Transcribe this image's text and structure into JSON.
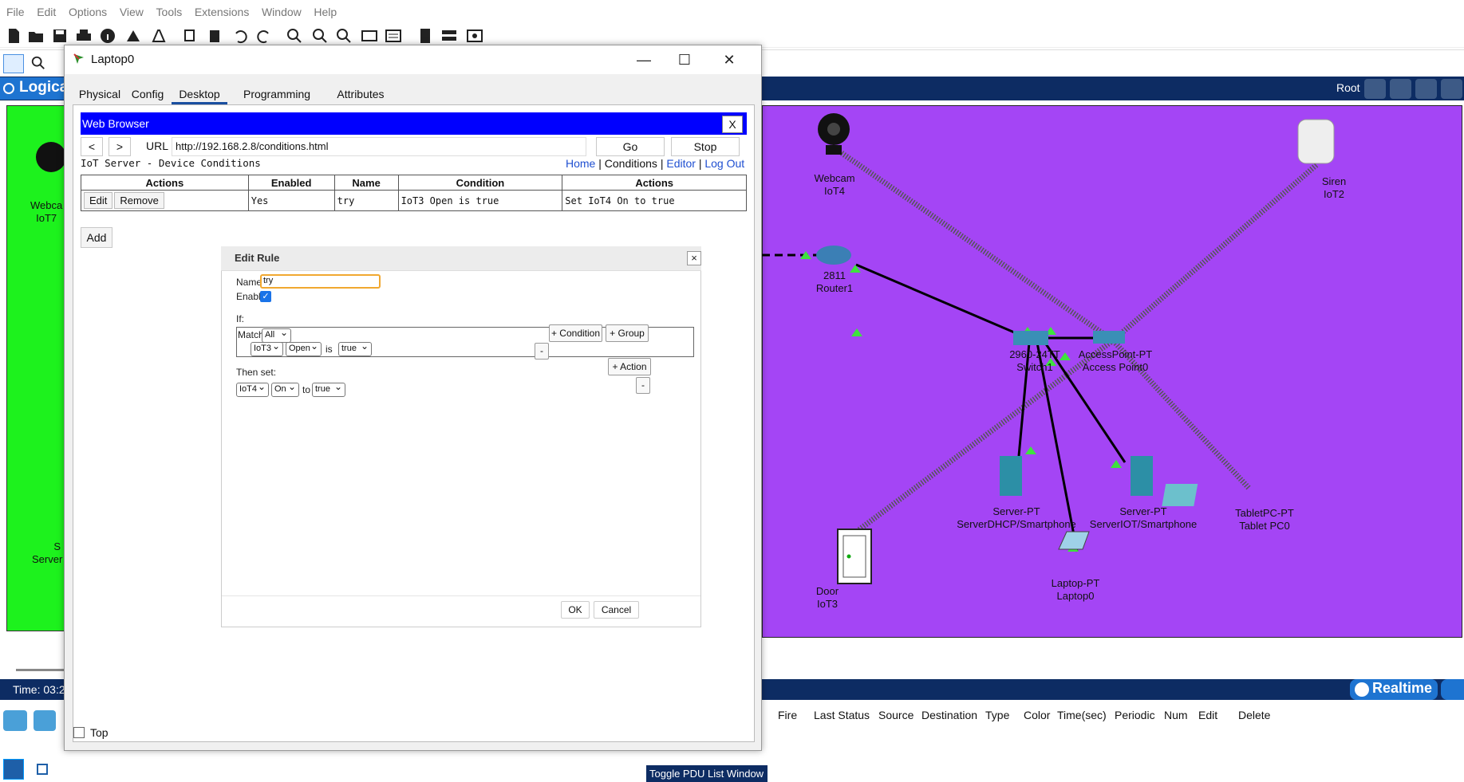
{
  "app": {
    "menu": [
      "File",
      "Edit",
      "Options",
      "View",
      "Tools",
      "Extensions",
      "Window",
      "Help"
    ],
    "logical_tab": "Logical",
    "root_label": "Root",
    "time_text": "Time: 03:2",
    "realtime_label": "Realtime",
    "toggle_pdu_label": "Toggle PDU List Window",
    "pdu_columns": [
      "Fire",
      "Last Status",
      "Source",
      "Destination",
      "Type",
      "Color",
      "Time(sec)",
      "Periodic",
      "Num",
      "Edit",
      "Delete"
    ]
  },
  "network": {
    "left_devices": {
      "webcam_label_1": "Webca",
      "webcam_label_2": "IoT7",
      "server_label_1": "S",
      "server_label_2": "Server"
    },
    "devices": [
      {
        "id": "webcam",
        "line1": "Webcam",
        "line2": "IoT4"
      },
      {
        "id": "siren",
        "line1": "Siren",
        "line2": "IoT2"
      },
      {
        "id": "router",
        "line1": "2811",
        "line2": "Router1"
      },
      {
        "id": "switch",
        "line1": "2960-24TT",
        "line2": "Switch1"
      },
      {
        "id": "ap",
        "line1": "AccessPoint-PT",
        "line2": "Access Point0"
      },
      {
        "id": "server_dhcp",
        "line1": "Server-PT",
        "line2": "ServerDHCP/Smartphone"
      },
      {
        "id": "server_iot",
        "line1": "Server-PT",
        "line2": "ServerIOT/Smartphone"
      },
      {
        "id": "tablet",
        "line1": "TabletPC-PT",
        "line2": "Tablet PC0"
      },
      {
        "id": "door",
        "line1": "Door",
        "line2": "IoT3"
      },
      {
        "id": "laptop",
        "line1": "Laptop-PT",
        "line2": "Laptop0"
      }
    ],
    "colors": {
      "purple_cluster": "#a445f5",
      "green_cluster": "#1df21d"
    }
  },
  "window": {
    "title": "Laptop0",
    "controls": {
      "minimize": "—",
      "maximize": "☐",
      "close": "✕"
    },
    "tabs": [
      "Physical",
      "Config",
      "Desktop",
      "Programming",
      "Attributes"
    ],
    "active_tab": "Desktop",
    "top_checkbox_label": "Top"
  },
  "browser": {
    "title": "Web Browser",
    "close": "X",
    "back": "<",
    "forward": ">",
    "url_label": "URL",
    "url": "http://192.168.2.8/conditions.html",
    "go": "Go",
    "stop": "Stop"
  },
  "iot_page": {
    "title": "IoT Server - Device Conditions",
    "nav": {
      "home": "Home",
      "conditions": "Conditions",
      "editor": "Editor",
      "logout": "Log Out",
      "sep": "|"
    },
    "table_headers": [
      "Actions",
      "Enabled",
      "Name",
      "Condition",
      "Actions"
    ],
    "rows": [
      {
        "edit": "Edit",
        "remove": "Remove",
        "enabled": "Yes",
        "name": "try",
        "condition": "IoT3 Open is true",
        "action": "Set IoT4 On to true"
      }
    ],
    "add_button": "Add"
  },
  "edit_rule": {
    "title": "Edit Rule",
    "close": "×",
    "name_label": "Name",
    "name_value": "try",
    "enabled_label": "Enabled",
    "enabled": true,
    "if_label": "If:",
    "match_label": "Match",
    "match_value": "All",
    "cond_device": "IoT3",
    "cond_property": "Open",
    "is_label": "is",
    "cond_value": "true",
    "add_condition": "+ Condition",
    "add_group": "+ Group",
    "remove_condition": "-",
    "then_label": "Then set:",
    "add_action": "+ Action",
    "remove_action": "-",
    "action_device": "IoT4",
    "action_property": "On",
    "to_label": "to",
    "action_value": "true",
    "ok": "OK",
    "cancel": "Cancel"
  }
}
